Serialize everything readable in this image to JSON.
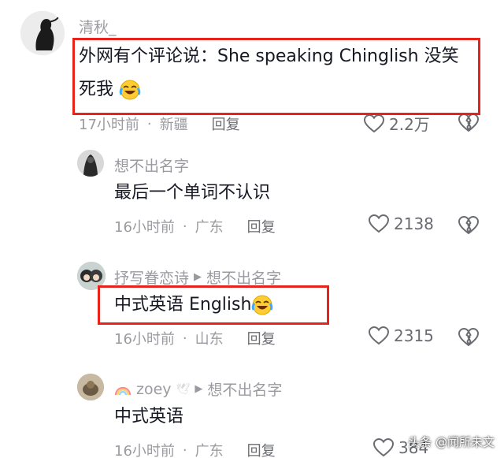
{
  "comments": [
    {
      "username": "清秋_",
      "text_line1": "外网有个评论说：She speaking Chinglish 没笑",
      "text_line2": "死我",
      "time": "17小时前",
      "location": "新疆",
      "reply_label": "回复",
      "likes": "2.2万"
    },
    {
      "username": "想不出名字",
      "text": "最后一个单词不认识",
      "time": "16小时前",
      "location": "广东",
      "reply_label": "回复",
      "likes": "2138"
    },
    {
      "username": "抒写眷恋诗",
      "reply_to": "想不出名字",
      "text": "中式英语 English",
      "time": "16小时前",
      "location": "山东",
      "reply_label": "回复",
      "likes": "2315"
    },
    {
      "username": "zoey",
      "reply_to": "想不出名字",
      "text": "中式英语",
      "time": "16小时前",
      "location": "广东",
      "reply_label": "回复",
      "likes": "384"
    }
  ],
  "separator": "·",
  "watermark": "头条 @闻所未文",
  "colors": {
    "highlight_box": "#e8231c",
    "meta_text": "#9a9ba0",
    "body_text": "#161823"
  },
  "icons": [
    "heart-icon",
    "broken-heart-icon",
    "laughing-crying-emoji",
    "reply-arrow-icon",
    "rainbow-icon"
  ]
}
